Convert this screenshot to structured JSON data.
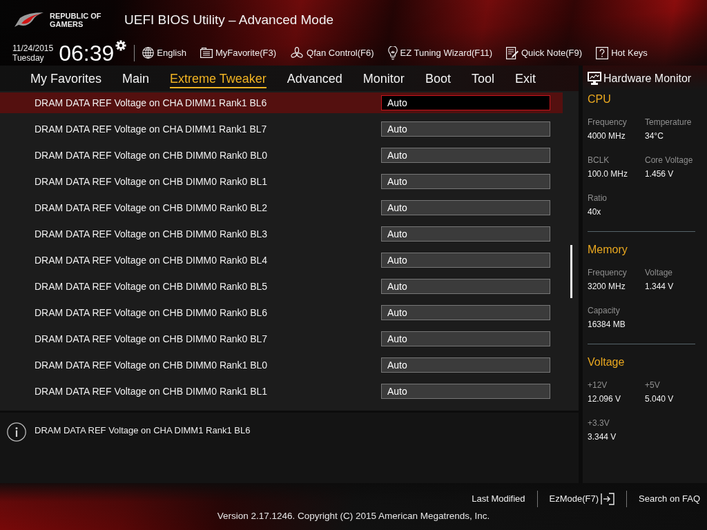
{
  "header": {
    "brand": "REPUBLIC OF GAMERS",
    "title": "UEFI BIOS Utility – Advanced Mode"
  },
  "toolbar": {
    "date": "11/24/2015",
    "weekday": "Tuesday",
    "time": "06:39",
    "items": [
      {
        "kind": "language",
        "label": "English"
      },
      {
        "kind": "favorite",
        "label": "MyFavorite(F3)"
      },
      {
        "kind": "fan",
        "label": "Qfan Control(F6)"
      },
      {
        "kind": "wizard",
        "label": "EZ Tuning Wizard(F11)"
      },
      {
        "kind": "note",
        "label": "Quick Note(F9)"
      },
      {
        "kind": "hotkeys",
        "label": "Hot Keys"
      }
    ]
  },
  "tabs": [
    {
      "label": "My Favorites",
      "selected": false
    },
    {
      "label": "Main",
      "selected": false
    },
    {
      "label": "Extreme Tweaker",
      "selected": true
    },
    {
      "label": "Advanced",
      "selected": false
    },
    {
      "label": "Monitor",
      "selected": false
    },
    {
      "label": "Boot",
      "selected": false
    },
    {
      "label": "Tool",
      "selected": false
    },
    {
      "label": "Exit",
      "selected": false
    }
  ],
  "settings": [
    {
      "label": "DRAM DATA REF Voltage on CHA DIMM1 Rank1 BL6",
      "value": "Auto",
      "selected": true
    },
    {
      "label": "DRAM DATA REF Voltage on CHA DIMM1 Rank1 BL7",
      "value": "Auto",
      "selected": false
    },
    {
      "label": "DRAM DATA REF Voltage on CHB DIMM0 Rank0 BL0",
      "value": "Auto",
      "selected": false
    },
    {
      "label": "DRAM DATA REF Voltage on CHB DIMM0 Rank0 BL1",
      "value": "Auto",
      "selected": false
    },
    {
      "label": "DRAM DATA REF Voltage on CHB DIMM0 Rank0 BL2",
      "value": "Auto",
      "selected": false
    },
    {
      "label": "DRAM DATA REF Voltage on CHB DIMM0 Rank0 BL3",
      "value": "Auto",
      "selected": false
    },
    {
      "label": "DRAM DATA REF Voltage on CHB DIMM0 Rank0 BL4",
      "value": "Auto",
      "selected": false
    },
    {
      "label": "DRAM DATA REF Voltage on CHB DIMM0 Rank0 BL5",
      "value": "Auto",
      "selected": false
    },
    {
      "label": "DRAM DATA REF Voltage on CHB DIMM0 Rank0 BL6",
      "value": "Auto",
      "selected": false
    },
    {
      "label": "DRAM DATA REF Voltage on CHB DIMM0 Rank0 BL7",
      "value": "Auto",
      "selected": false
    },
    {
      "label": "DRAM DATA REF Voltage on CHB DIMM0 Rank1 BL0",
      "value": "Auto",
      "selected": false
    },
    {
      "label": "DRAM DATA REF Voltage on CHB DIMM0 Rank1 BL1",
      "value": "Auto",
      "selected": false
    }
  ],
  "help": {
    "text": "DRAM DATA REF Voltage on CHA DIMM1 Rank1 BL6"
  },
  "hardware_monitor": {
    "title": "Hardware Monitor",
    "sections": [
      {
        "title": "CPU",
        "readings": [
          {
            "label": "Frequency",
            "value": "4000 MHz"
          },
          {
            "label": "Temperature",
            "value": "34°C"
          },
          {
            "label": "BCLK",
            "value": "100.0 MHz"
          },
          {
            "label": "Core Voltage",
            "value": "1.456 V"
          },
          {
            "label": "Ratio",
            "value": "40x"
          }
        ]
      },
      {
        "title": "Memory",
        "readings": [
          {
            "label": "Frequency",
            "value": "3200 MHz"
          },
          {
            "label": "Voltage",
            "value": "1.344 V"
          },
          {
            "label": "Capacity",
            "value": "16384 MB"
          }
        ]
      },
      {
        "title": "Voltage",
        "readings": [
          {
            "label": "+12V",
            "value": "12.096 V"
          },
          {
            "label": "+5V",
            "value": "5.040 V"
          },
          {
            "label": "+3.3V",
            "value": "3.344 V"
          }
        ]
      }
    ]
  },
  "footer": {
    "links": [
      {
        "kind": "link",
        "label": "Last Modified"
      },
      {
        "kind": "exit-link",
        "label": "EzMode(F7)"
      },
      {
        "kind": "link",
        "label": "Search on FAQ"
      }
    ],
    "version": "Version 2.17.1246. Copyright (C) 2015 American Megatrends, Inc."
  }
}
